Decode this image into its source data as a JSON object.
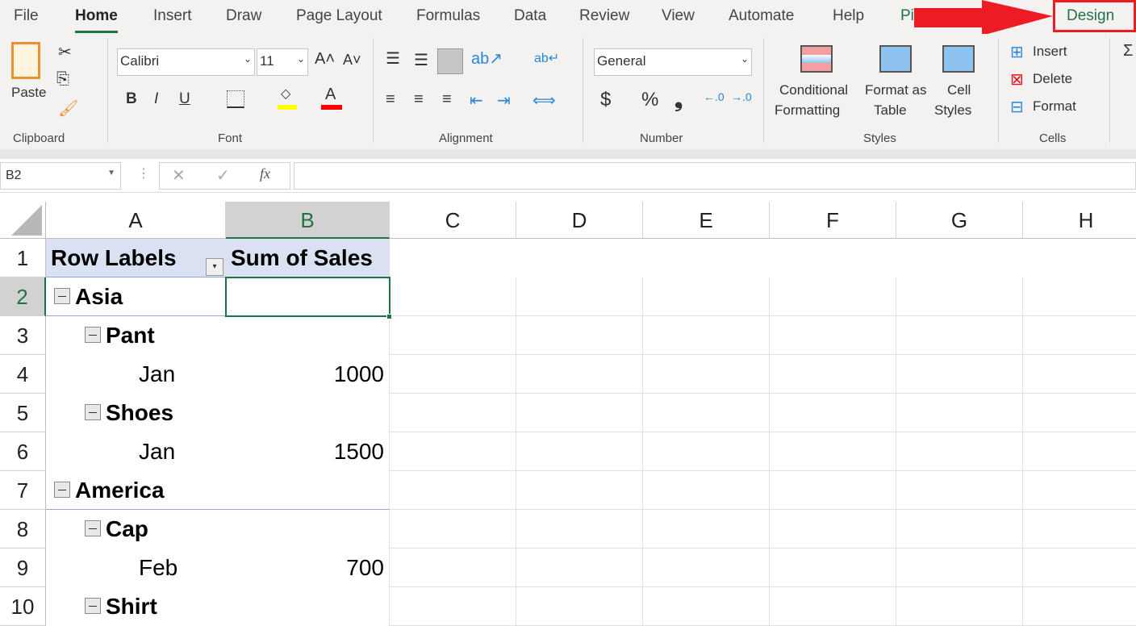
{
  "tabs": [
    "File",
    "Home",
    "Insert",
    "Draw",
    "Page Layout",
    "Formulas",
    "Data",
    "Review",
    "View",
    "Automate",
    "Help",
    "Piv",
    "Design"
  ],
  "ribbon": {
    "clipboard": {
      "paste": "Paste",
      "label": "Clipboard"
    },
    "font": {
      "name": "Calibri",
      "size": "11",
      "label": "Font",
      "bold": "B",
      "italic": "I",
      "underline": "U",
      "fill_color": "#ffff00",
      "font_color": "#ff0000"
    },
    "alignment": {
      "label": "Alignment"
    },
    "number": {
      "format": "General",
      "label": "Number",
      "currency": "$",
      "percent": "%",
      "comma": "❟"
    },
    "styles": {
      "conditional": "Conditional",
      "formatting": "Formatting",
      "format_as": "Format as",
      "table": "Table",
      "cell": "Cell",
      "styles": "Styles",
      "label": "Styles"
    },
    "cells": {
      "insert": "Insert",
      "delete": "Delete",
      "format": "Format",
      "label": "Cells"
    }
  },
  "formula_bar": {
    "name_box": "B2",
    "fx": "fx",
    "value": ""
  },
  "columns": [
    "A",
    "B",
    "C",
    "D",
    "E",
    "F",
    "G",
    "H"
  ],
  "rows": [
    "1",
    "2",
    "3",
    "4",
    "5",
    "6",
    "7",
    "8",
    "9",
    "10"
  ],
  "pivot": {
    "header": [
      "Row Labels",
      "Sum of Sales"
    ],
    "items": [
      {
        "label": "Asia",
        "level": 0,
        "value": ""
      },
      {
        "label": "Pant",
        "level": 1,
        "value": ""
      },
      {
        "label": "Jan",
        "level": 2,
        "value": "1000"
      },
      {
        "label": "Shoes",
        "level": 1,
        "value": ""
      },
      {
        "label": "Jan",
        "level": 2,
        "value": "1500"
      },
      {
        "label": "America",
        "level": 0,
        "value": ""
      },
      {
        "label": "Cap",
        "level": 1,
        "value": ""
      },
      {
        "label": "Feb",
        "level": 2,
        "value": "700"
      },
      {
        "label": "Shirt",
        "level": 1,
        "value": ""
      }
    ]
  },
  "selected_cell": "B2",
  "annotation_color": "#ed1c24"
}
